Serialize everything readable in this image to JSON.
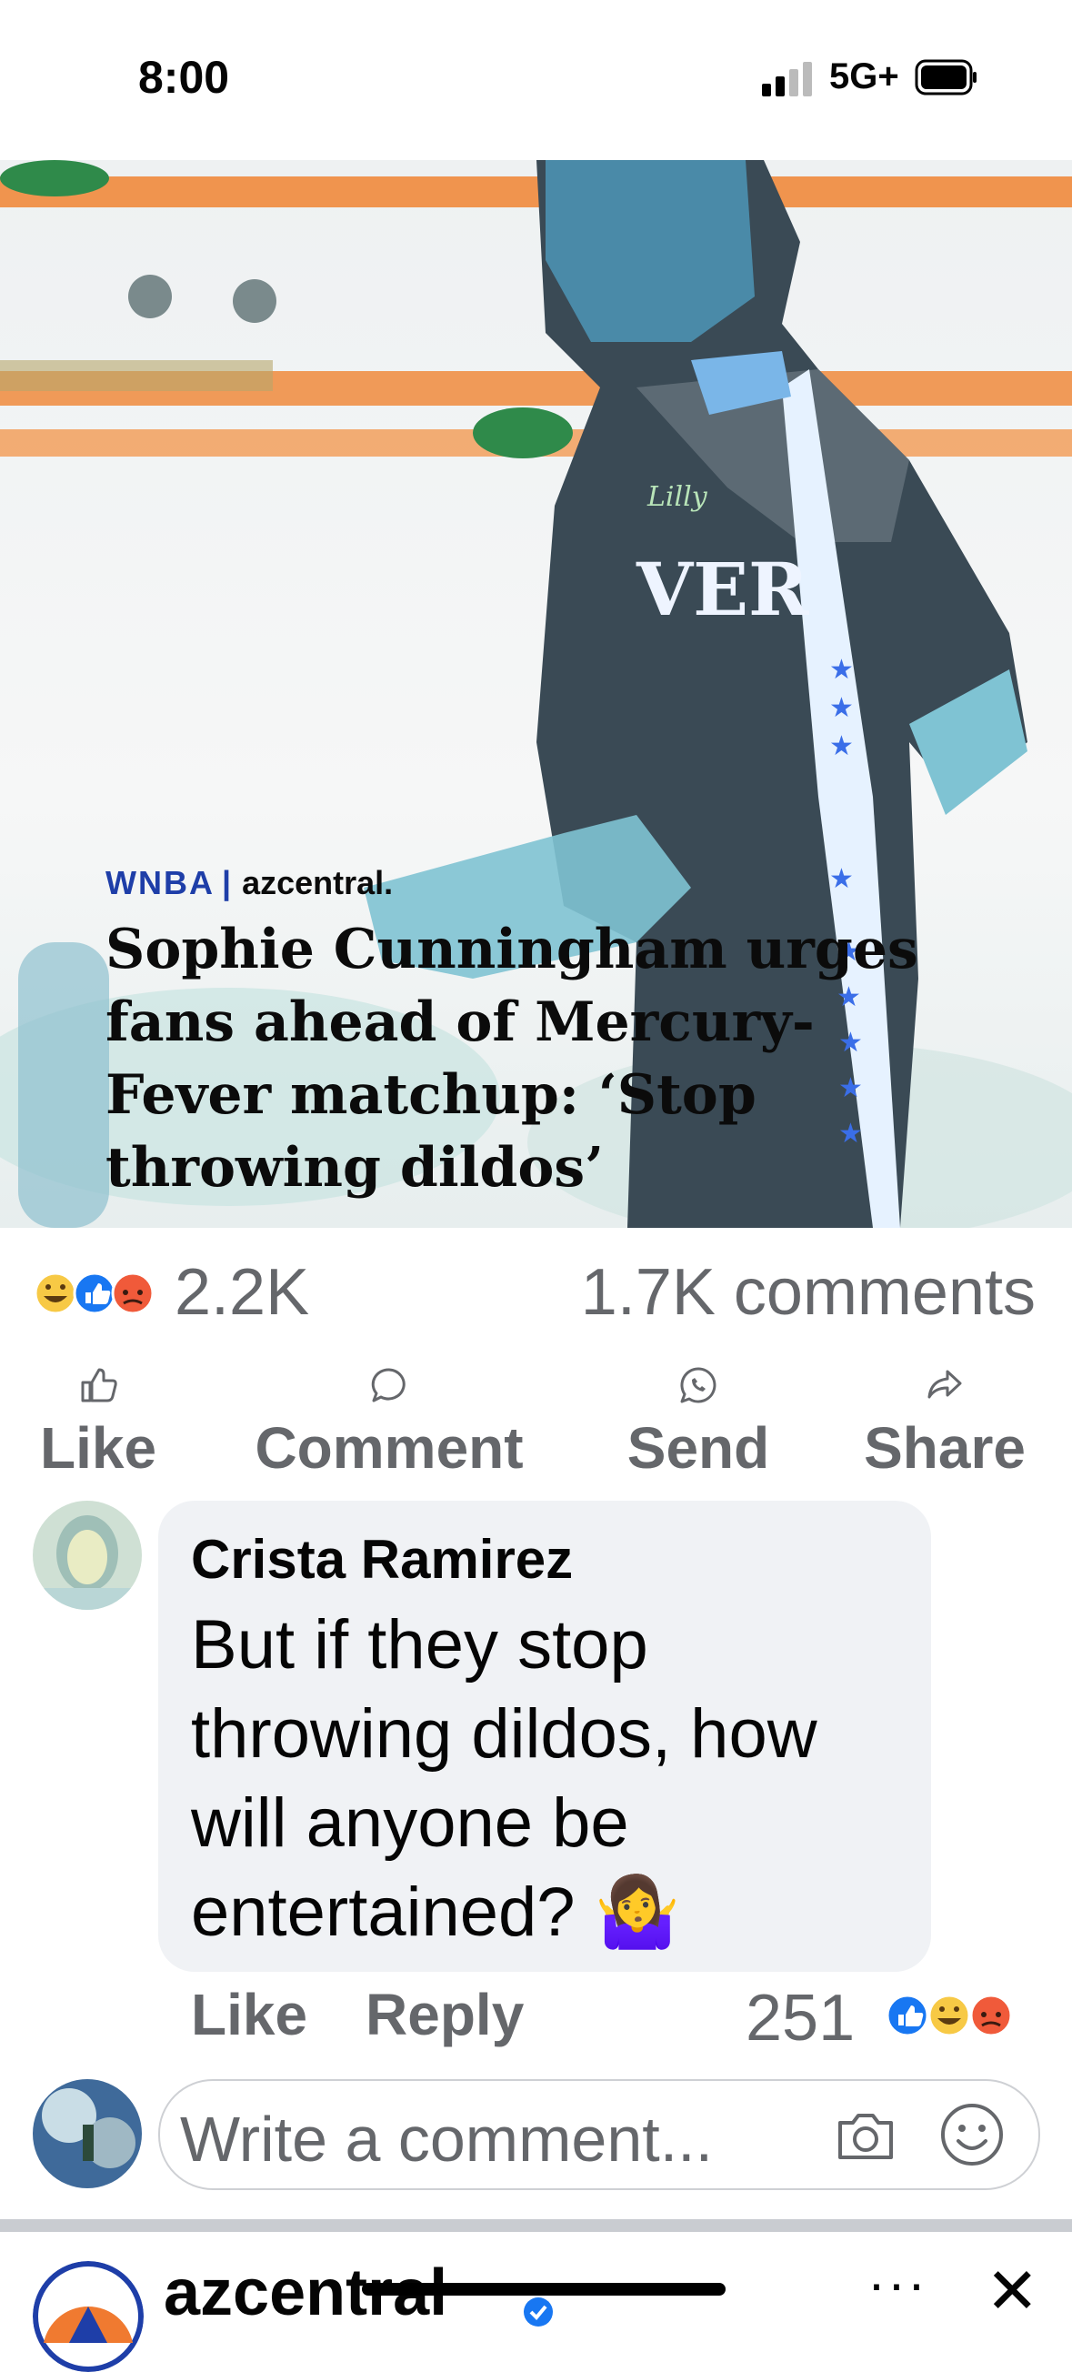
{
  "status_bar": {
    "time": "8:00",
    "network": "5G+"
  },
  "article": {
    "category": "WNBA",
    "separator": "|",
    "publisher": "azcentral.",
    "title": "Sophie Cunningham urges fans ahead of Mercury-Fever matchup: ‘Stop throwing dildos’",
    "jersey_text": "VER",
    "jersey_brand": "Lilly"
  },
  "stats": {
    "reactions_count": "2.2K",
    "comments_count": "1.7K comments"
  },
  "actions": [
    {
      "label": "Like",
      "icon": "thumbs-up-icon"
    },
    {
      "label": "Comment",
      "icon": "comment-bubble-icon"
    },
    {
      "label": "Send",
      "icon": "whatsapp-icon"
    },
    {
      "label": "Share",
      "icon": "share-arrow-icon"
    }
  ],
  "comment": {
    "author": "Crista Ramirez",
    "text": "But if they stop throwing dildos, how will anyone be entertained? 🤷‍♀️",
    "like_label": "Like",
    "reply_label": "Reply",
    "reaction_count": "251"
  },
  "composer": {
    "placeholder": "Write a comment..."
  },
  "next_post": {
    "page_name": "azcentral",
    "more": "···",
    "close": "✕"
  },
  "colors": {
    "fb_blue": "#1877f2",
    "muted": "#65676b",
    "bubble": "#f0f2f5",
    "brand_blue": "#1e3ea8"
  }
}
